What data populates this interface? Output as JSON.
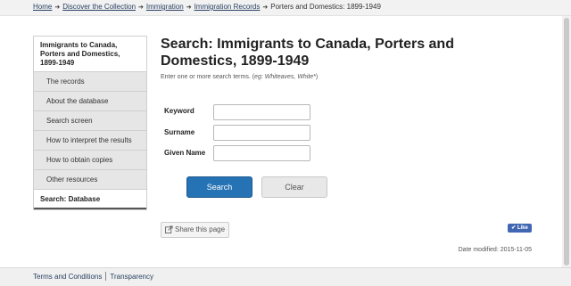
{
  "breadcrumb": {
    "items": [
      "Home",
      "Discover the Collection",
      "Immigration",
      "Immigration Records"
    ],
    "current": "Porters and Domestics: 1899-1949",
    "separator": "➔"
  },
  "sidebar": {
    "heading": "Immigrants to Canada, Porters and Domestics, 1899-1949",
    "items": [
      {
        "label": "The records"
      },
      {
        "label": "About the database"
      },
      {
        "label": "Search screen"
      },
      {
        "label": "How to interpret the results"
      },
      {
        "label": "How to obtain copies"
      },
      {
        "label": "Other resources"
      }
    ],
    "active_item": "Search: Database"
  },
  "main": {
    "title": "Search: Immigrants to Canada, Porters and Domestics, 1899-1949",
    "instructions_prefix": "Enter one or more search terms. (",
    "instructions_example": "eg: Whiteaves, White*",
    "instructions_suffix": ")",
    "form": {
      "keyword_label": "Keyword",
      "keyword_value": "",
      "surname_label": "Surname",
      "surname_value": "",
      "given_name_label": "Given Name",
      "given_name_value": ""
    },
    "search_button": "Search",
    "clear_button": "Clear",
    "share_button": "Share this page",
    "like_button": "Like",
    "date_modified": "Date modified: 2015-11-05"
  },
  "footer": {
    "links": [
      "Terms and Conditions",
      "Transparency"
    ]
  },
  "colors": {
    "primary_button": "#2572b4",
    "link": "#284162",
    "facebook": "#4267b2"
  }
}
